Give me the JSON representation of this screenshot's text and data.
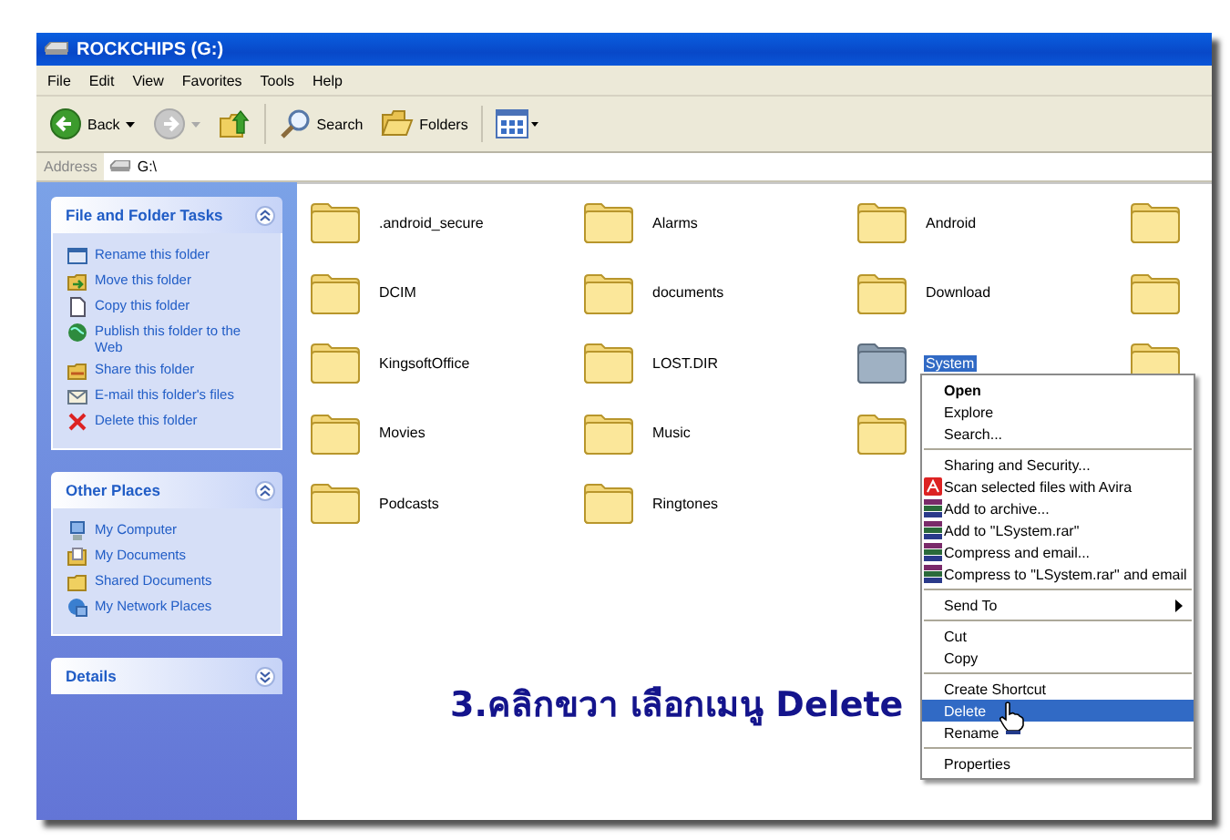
{
  "window": {
    "title": "ROCKCHIPS (G:)"
  },
  "menu_bar": [
    "File",
    "Edit",
    "View",
    "Favorites",
    "Tools",
    "Help"
  ],
  "toolbar": [
    {
      "kind": "back",
      "label": "Back",
      "disabled": false
    },
    {
      "kind": "forward",
      "disabled": true
    },
    {
      "kind": "up"
    },
    {
      "kind": "search",
      "label": "Search"
    },
    {
      "kind": "folders",
      "label": "Folders"
    },
    {
      "kind": "views"
    }
  ],
  "address": {
    "label": "Address",
    "value": "G:\\"
  },
  "sidebar": {
    "panels": [
      {
        "title": "File and Folder Tasks",
        "expanded": true,
        "items": [
          {
            "label": "Rename this folder"
          },
          {
            "label": "Move this folder"
          },
          {
            "label": "Copy this folder"
          },
          {
            "label": "Publish this folder to the Web"
          },
          {
            "label": "Share this folder"
          },
          {
            "label": "E-mail this folder's files"
          },
          {
            "label": "Delete this folder"
          }
        ]
      },
      {
        "title": "Other Places",
        "expanded": true,
        "items": [
          {
            "label": "My Computer"
          },
          {
            "label": "My Documents"
          },
          {
            "label": "Shared Documents"
          },
          {
            "label": "My Network Places"
          }
        ]
      },
      {
        "title": "Details",
        "expanded": false
      }
    ]
  },
  "folders": [
    {
      "label": ".android_secure",
      "selected": false
    },
    {
      "label": "Alarms",
      "selected": false
    },
    {
      "label": "Android",
      "selected": false
    },
    {
      "selected": false
    },
    {
      "label": "DCIM",
      "selected": false
    },
    {
      "label": "documents",
      "selected": false
    },
    {
      "label": "Download",
      "selected": false
    },
    {
      "selected": false
    },
    {
      "label": "KingsoftOffice",
      "selected": false
    },
    {
      "label": "LOST.DIR",
      "selected": false
    },
    {
      "label": "System",
      "selected": true
    },
    {
      "selected": false
    },
    {
      "label": "Movies",
      "selected": false
    },
    {
      "label": "Music",
      "selected": false
    },
    {
      "selected": false
    },
    {
      "label": "Podcasts",
      "selected": false
    },
    {
      "label": "Ringtones",
      "selected": false
    }
  ],
  "context_menu": {
    "groups": [
      [
        {
          "label": "Open",
          "kind": "plain",
          "default": true,
          "selected": false
        },
        {
          "label": "Explore",
          "kind": "plain",
          "default": false,
          "selected": false
        },
        {
          "label": "Search...",
          "kind": "plain",
          "default": false,
          "selected": false
        }
      ],
      [
        {
          "label": "Sharing and Security...",
          "kind": "plain",
          "default": false,
          "selected": false
        },
        {
          "label": "Scan selected files with Avira",
          "kind": "scan",
          "default": false,
          "selected": false
        },
        {
          "label": "Add to archive...",
          "kind": "archive",
          "default": false,
          "selected": false
        },
        {
          "label": "Add to \"LSystem.rar\"",
          "kind": "archive",
          "default": false,
          "selected": false
        },
        {
          "label": "Compress and email...",
          "kind": "archive",
          "default": false,
          "selected": false
        },
        {
          "label": "Compress to \"LSystem.rar\" and email",
          "kind": "archive",
          "default": false,
          "selected": false
        }
      ],
      [
        {
          "label": "Send To",
          "kind": "submenu",
          "default": false,
          "selected": false
        }
      ],
      [
        {
          "label": "Cut",
          "kind": "plain",
          "default": false,
          "selected": false
        },
        {
          "label": "Copy",
          "kind": "plain",
          "default": false,
          "selected": false
        }
      ],
      [
        {
          "label": "Create Shortcut",
          "kind": "plain",
          "default": false,
          "selected": false
        },
        {
          "label": "Delete",
          "kind": "plain",
          "default": false,
          "selected": true
        },
        {
          "label": "Rename",
          "kind": "plain",
          "default": false,
          "selected": false
        }
      ],
      [
        {
          "label": "Properties",
          "kind": "plain",
          "default": false,
          "selected": false
        }
      ]
    ]
  },
  "caption": "3.คลิกขวา เลือกเมนู Delete"
}
